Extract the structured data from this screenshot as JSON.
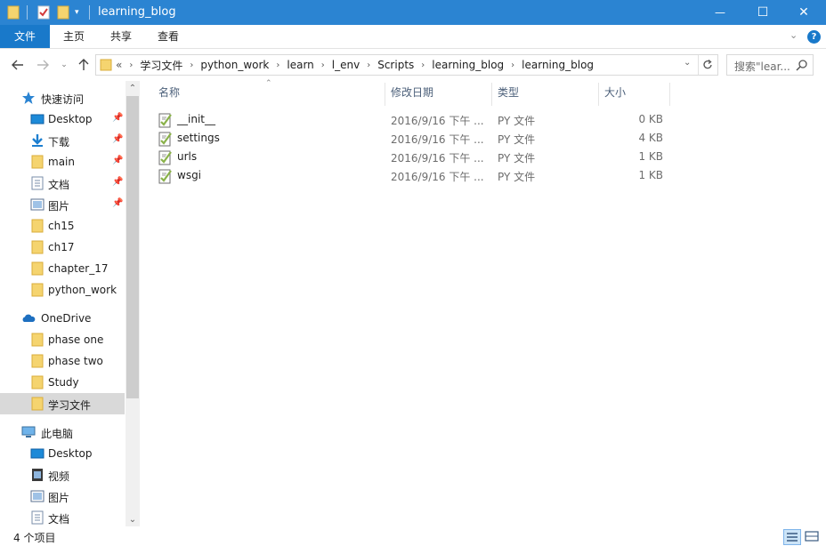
{
  "window": {
    "title": "learning_blog",
    "minimize_glyph": "—",
    "maximize_glyph": "☐",
    "close_glyph": "✕"
  },
  "ribbon": {
    "tabs": [
      {
        "label": "文件",
        "active": true
      },
      {
        "label": "主页",
        "active": false
      },
      {
        "label": "共享",
        "active": false
      },
      {
        "label": "查看",
        "active": false
      }
    ],
    "help_glyph": "?"
  },
  "address": {
    "overflow": "«",
    "breadcrumbs": [
      "学习文件",
      "python_work",
      "learn",
      "l_env",
      "Scripts",
      "learning_blog",
      "learning_blog"
    ]
  },
  "search": {
    "placeholder": "搜索\"lear..."
  },
  "nav_pane": {
    "quick_access": {
      "label": "快速访问"
    },
    "quick_items": [
      {
        "label": "Desktop",
        "icon": "desktop-icon",
        "pinned": true
      },
      {
        "label": "下载",
        "icon": "download-icon",
        "pinned": true
      },
      {
        "label": "main",
        "icon": "folder-icon",
        "pinned": true
      },
      {
        "label": "文档",
        "icon": "document-icon",
        "pinned": true
      },
      {
        "label": "图片",
        "icon": "picture-icon",
        "pinned": true
      },
      {
        "label": "ch15",
        "icon": "folder-icon",
        "pinned": false
      },
      {
        "label": "ch17",
        "icon": "folder-icon",
        "pinned": false
      },
      {
        "label": "chapter_17",
        "icon": "folder-icon",
        "pinned": false
      },
      {
        "label": "python_work",
        "icon": "folder-icon",
        "pinned": false
      }
    ],
    "onedrive": {
      "label": "OneDrive"
    },
    "onedrive_items": [
      {
        "label": "phase one",
        "icon": "folder-icon"
      },
      {
        "label": "phase two",
        "icon": "folder-icon"
      },
      {
        "label": "Study",
        "icon": "folder-icon"
      },
      {
        "label": "学习文件",
        "icon": "folder-icon",
        "selected": true
      }
    ],
    "this_pc": {
      "label": "此电脑"
    },
    "pc_items": [
      {
        "label": "Desktop",
        "icon": "desktop-icon"
      },
      {
        "label": "视频",
        "icon": "video-icon"
      },
      {
        "label": "图片",
        "icon": "picture-icon"
      },
      {
        "label": "文档",
        "icon": "document-icon"
      }
    ]
  },
  "file_list": {
    "columns": {
      "name": "名称",
      "date": "修改日期",
      "type": "类型",
      "size": "大小"
    },
    "files": [
      {
        "name": "__init__",
        "date": "2016/9/16 下午 ...",
        "type": "PY 文件",
        "size": "0 KB"
      },
      {
        "name": "settings",
        "date": "2016/9/16 下午 ...",
        "type": "PY 文件",
        "size": "4 KB"
      },
      {
        "name": "urls",
        "date": "2016/9/16 下午 ...",
        "type": "PY 文件",
        "size": "1 KB"
      },
      {
        "name": "wsgi",
        "date": "2016/9/16 下午 ...",
        "type": "PY 文件",
        "size": "1 KB"
      }
    ]
  },
  "status": {
    "item_count": "4 个项目"
  },
  "colors": {
    "titlebar": "#2b84d2",
    "active_tab": "#1979ca",
    "selection": "#d9d9d9",
    "folder": "#f5d46f"
  }
}
